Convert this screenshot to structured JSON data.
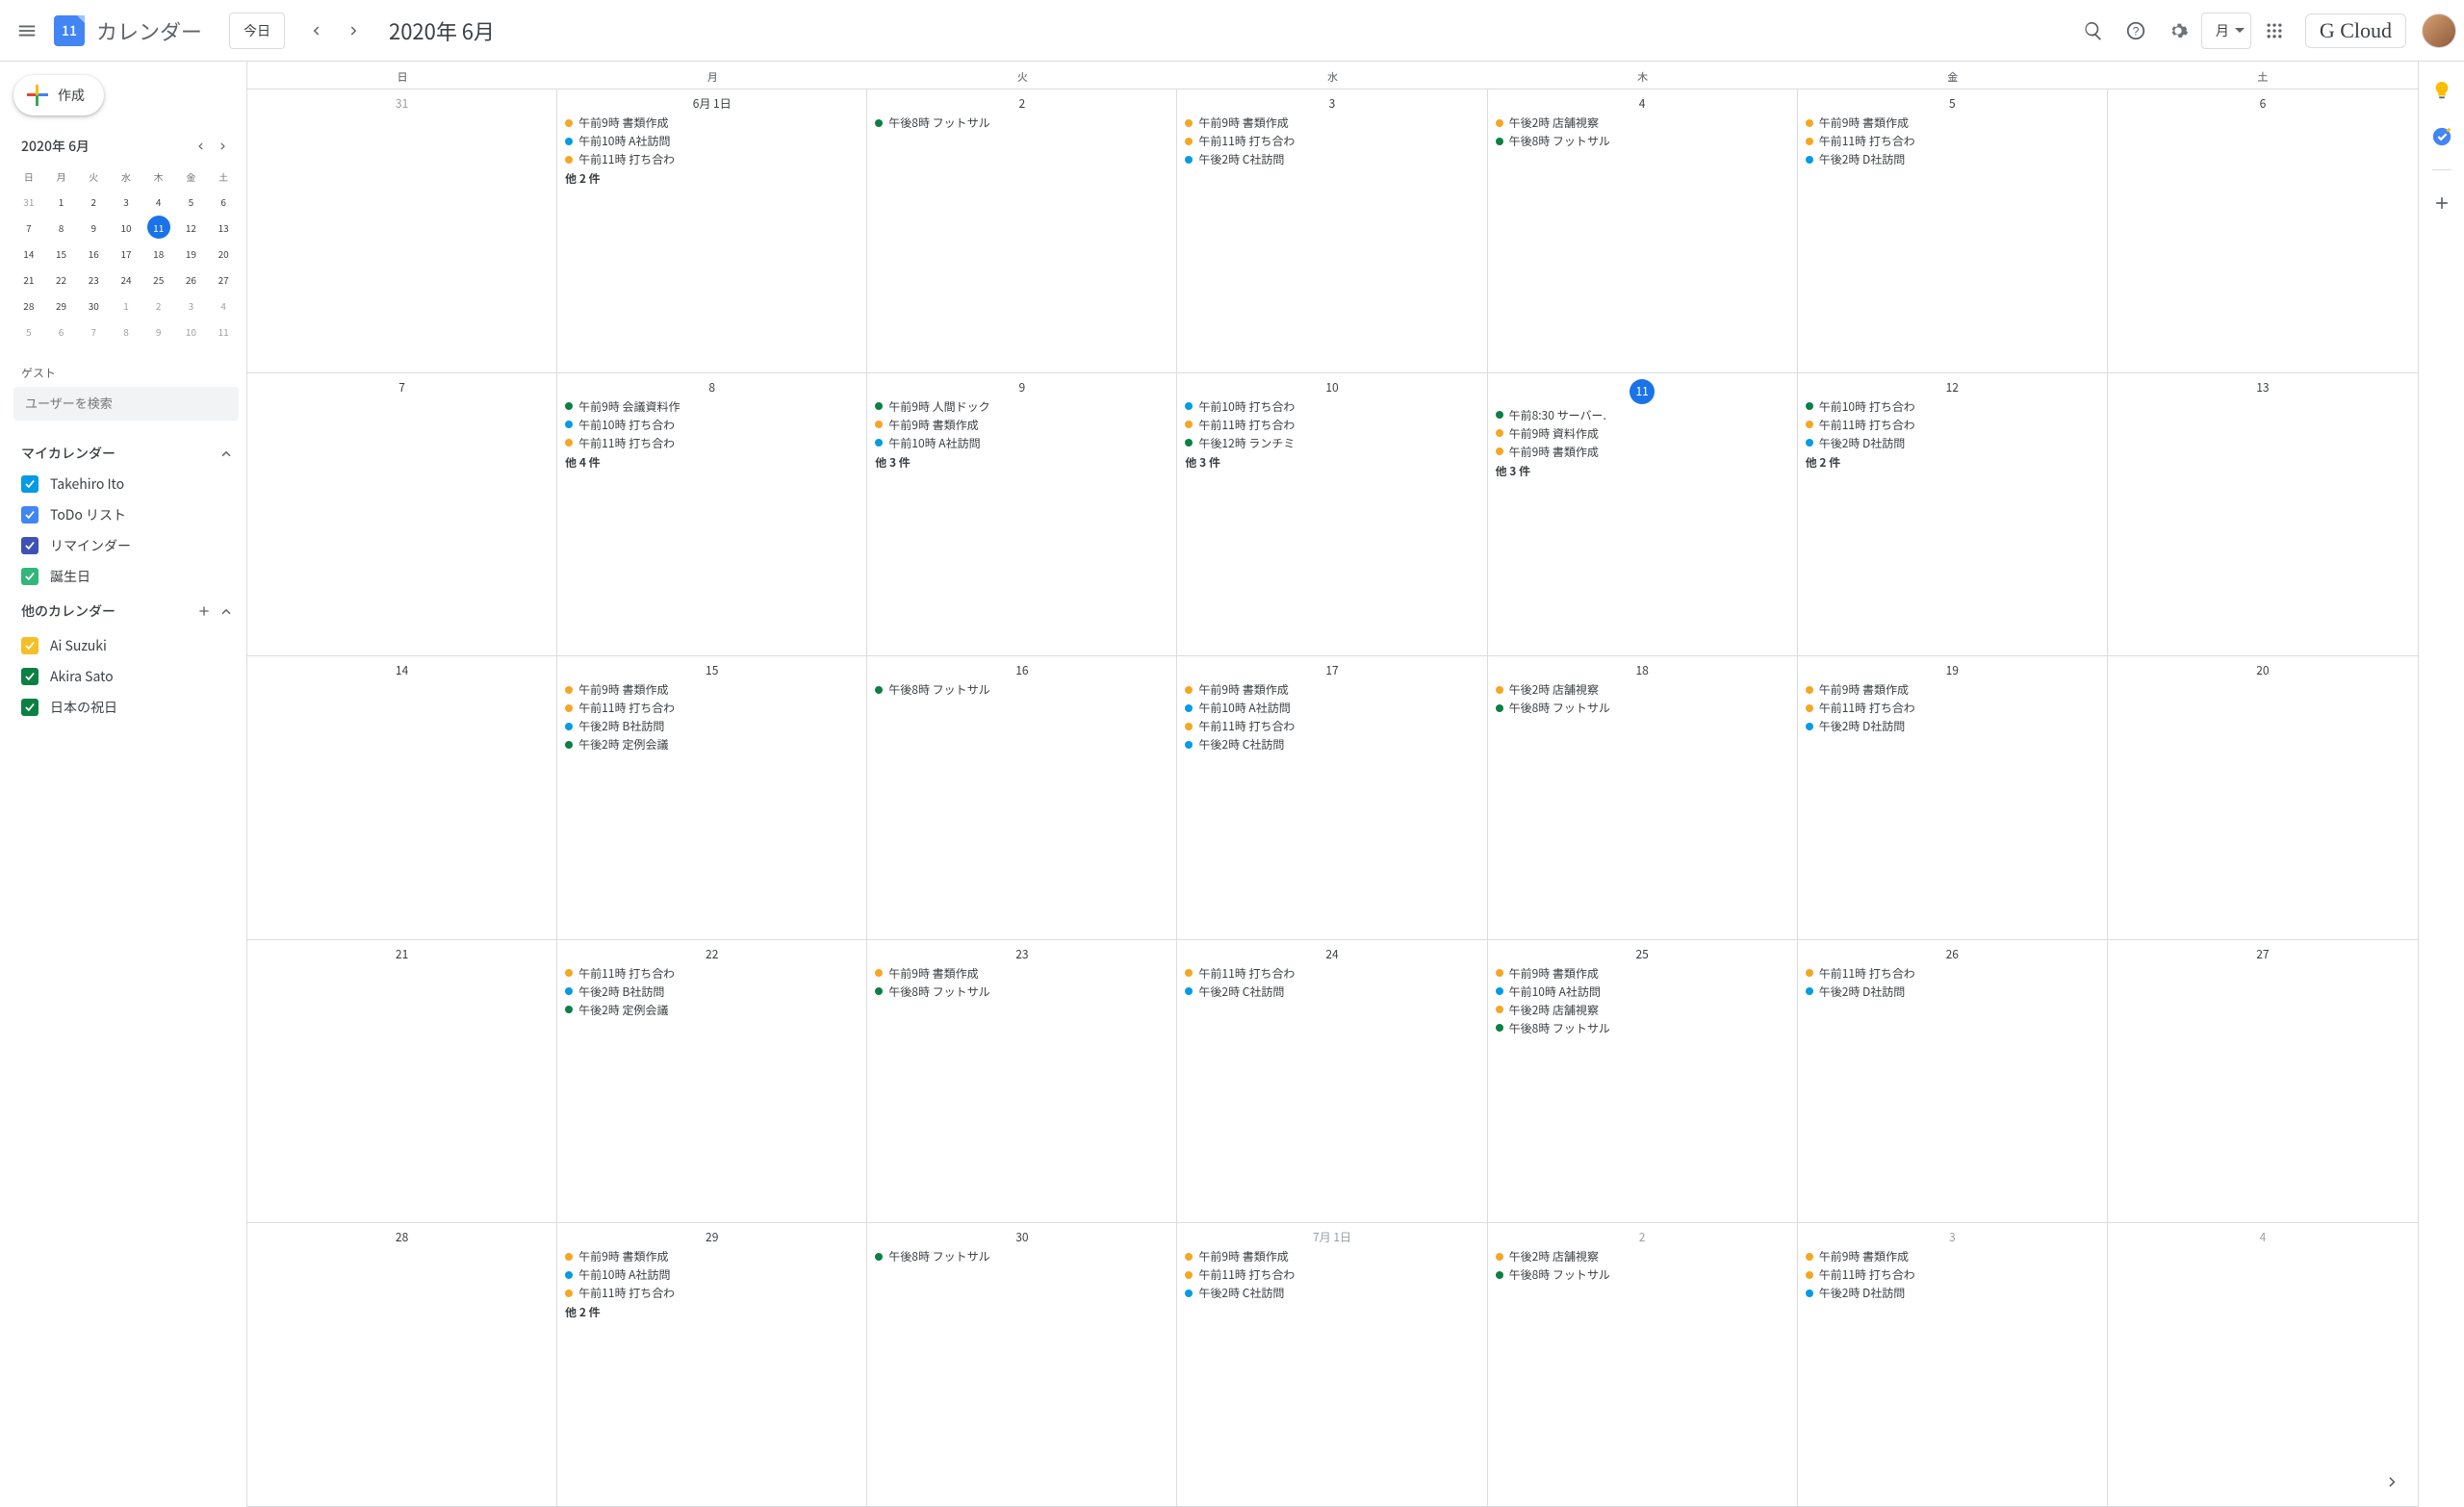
{
  "header": {
    "logo_day": "11",
    "app_title": "カレンダー",
    "today_label": "今日",
    "current_date": "2020年 6月",
    "view_label": "月",
    "brand": "G Cloud"
  },
  "sidebar": {
    "create_label": "作成",
    "mini_title": "2020年 6月",
    "mini_dow": [
      "日",
      "月",
      "火",
      "水",
      "木",
      "金",
      "土"
    ],
    "mini_days": [
      {
        "n": "31",
        "dim": true
      },
      {
        "n": "1"
      },
      {
        "n": "2"
      },
      {
        "n": "3"
      },
      {
        "n": "4"
      },
      {
        "n": "5"
      },
      {
        "n": "6"
      },
      {
        "n": "7"
      },
      {
        "n": "8"
      },
      {
        "n": "9"
      },
      {
        "n": "10"
      },
      {
        "n": "11",
        "today": true
      },
      {
        "n": "12"
      },
      {
        "n": "13"
      },
      {
        "n": "14"
      },
      {
        "n": "15"
      },
      {
        "n": "16"
      },
      {
        "n": "17"
      },
      {
        "n": "18"
      },
      {
        "n": "19"
      },
      {
        "n": "20"
      },
      {
        "n": "21"
      },
      {
        "n": "22"
      },
      {
        "n": "23"
      },
      {
        "n": "24"
      },
      {
        "n": "25"
      },
      {
        "n": "26"
      },
      {
        "n": "27"
      },
      {
        "n": "28"
      },
      {
        "n": "29"
      },
      {
        "n": "30"
      },
      {
        "n": "1",
        "dim": true
      },
      {
        "n": "2",
        "dim": true
      },
      {
        "n": "3",
        "dim": true
      },
      {
        "n": "4",
        "dim": true
      },
      {
        "n": "5",
        "dim": true
      },
      {
        "n": "6",
        "dim": true
      },
      {
        "n": "7",
        "dim": true
      },
      {
        "n": "8",
        "dim": true
      },
      {
        "n": "9",
        "dim": true
      },
      {
        "n": "10",
        "dim": true
      },
      {
        "n": "11",
        "dim": true
      }
    ],
    "guest_label": "ゲスト",
    "guest_placeholder": "ユーザーを検索",
    "my_cals_label": "マイカレンダー",
    "my_cals": [
      {
        "label": "Takehiro Ito",
        "color": "#039be5"
      },
      {
        "label": "ToDo リスト",
        "color": "#4285f4"
      },
      {
        "label": "リマインダー",
        "color": "#3f51b5"
      },
      {
        "label": "誕生日",
        "color": "#33b679"
      }
    ],
    "other_cals_label": "他のカレンダー",
    "other_cals": [
      {
        "label": "Ai Suzuki",
        "color": "#f6bf26"
      },
      {
        "label": "Akira Sato",
        "color": "#0b8043"
      },
      {
        "label": "日本の祝日",
        "color": "#0b8043"
      }
    ]
  },
  "calendar": {
    "dow": [
      "日",
      "月",
      "火",
      "水",
      "木",
      "金",
      "土"
    ],
    "colors": {
      "orange": "#f5a623",
      "blue": "#039be5",
      "green": "#0b8043"
    },
    "cells": [
      {
        "date": "31",
        "dim": true,
        "events": []
      },
      {
        "date": "6月 1日",
        "events": [
          {
            "c": "orange",
            "t": "午前9時 書類作成"
          },
          {
            "c": "blue",
            "t": "午前10時 A社訪問"
          },
          {
            "c": "orange",
            "t": "午前11時 打ち合わ"
          }
        ],
        "more": "他 2 件"
      },
      {
        "date": "2",
        "events": [
          {
            "c": "green",
            "t": "午後8時 フットサル"
          }
        ]
      },
      {
        "date": "3",
        "events": [
          {
            "c": "orange",
            "t": "午前9時 書類作成"
          },
          {
            "c": "orange",
            "t": "午前11時 打ち合わ"
          },
          {
            "c": "blue",
            "t": "午後2時 C社訪問"
          }
        ]
      },
      {
        "date": "4",
        "events": [
          {
            "c": "orange",
            "t": "午後2時 店舗視察"
          },
          {
            "c": "green",
            "t": "午後8時 フットサル"
          }
        ]
      },
      {
        "date": "5",
        "events": [
          {
            "c": "orange",
            "t": "午前9時 書類作成"
          },
          {
            "c": "orange",
            "t": "午前11時 打ち合わ"
          },
          {
            "c": "blue",
            "t": "午後2時 D社訪問"
          }
        ]
      },
      {
        "date": "6",
        "events": []
      },
      {
        "date": "7",
        "events": []
      },
      {
        "date": "8",
        "events": [
          {
            "c": "green",
            "t": "午前9時 会議資料作"
          },
          {
            "c": "blue",
            "t": "午前10時 打ち合わ"
          },
          {
            "c": "orange",
            "t": "午前11時 打ち合わ"
          }
        ],
        "more": "他 4 件"
      },
      {
        "date": "9",
        "events": [
          {
            "c": "green",
            "t": "午前9時 人間ドック"
          },
          {
            "c": "orange",
            "t": "午前9時 書類作成"
          },
          {
            "c": "blue",
            "t": "午前10時 A社訪問"
          }
        ],
        "more": "他 3 件"
      },
      {
        "date": "10",
        "events": [
          {
            "c": "blue",
            "t": "午前10時 打ち合わ"
          },
          {
            "c": "orange",
            "t": "午前11時 打ち合わ"
          },
          {
            "c": "green",
            "t": "午後12時 ランチミ"
          }
        ],
        "more": "他 3 件"
      },
      {
        "date": "11",
        "today": true,
        "events": [
          {
            "c": "green",
            "t": "午前8:30 サーバー."
          },
          {
            "c": "orange",
            "t": "午前9時 資料作成"
          },
          {
            "c": "orange",
            "t": "午前9時 書類作成"
          }
        ],
        "more": "他 3 件"
      },
      {
        "date": "12",
        "events": [
          {
            "c": "green",
            "t": "午前10時 打ち合わ"
          },
          {
            "c": "orange",
            "t": "午前11時 打ち合わ"
          },
          {
            "c": "blue",
            "t": "午後2時 D社訪問"
          }
        ],
        "more": "他 2 件"
      },
      {
        "date": "13",
        "events": []
      },
      {
        "date": "14",
        "events": []
      },
      {
        "date": "15",
        "events": [
          {
            "c": "orange",
            "t": "午前9時 書類作成"
          },
          {
            "c": "orange",
            "t": "午前11時 打ち合わ"
          },
          {
            "c": "blue",
            "t": "午後2時 B社訪問"
          },
          {
            "c": "green",
            "t": "午後2時 定例会議"
          }
        ]
      },
      {
        "date": "16",
        "events": [
          {
            "c": "green",
            "t": "午後8時 フットサル"
          }
        ]
      },
      {
        "date": "17",
        "events": [
          {
            "c": "orange",
            "t": "午前9時 書類作成"
          },
          {
            "c": "blue",
            "t": "午前10時 A社訪問"
          },
          {
            "c": "orange",
            "t": "午前11時 打ち合わ"
          },
          {
            "c": "blue",
            "t": "午後2時 C社訪問"
          }
        ]
      },
      {
        "date": "18",
        "events": [
          {
            "c": "orange",
            "t": "午後2時 店舗視察"
          },
          {
            "c": "green",
            "t": "午後8時 フットサル"
          }
        ]
      },
      {
        "date": "19",
        "events": [
          {
            "c": "orange",
            "t": "午前9時 書類作成"
          },
          {
            "c": "orange",
            "t": "午前11時 打ち合わ"
          },
          {
            "c": "blue",
            "t": "午後2時 D社訪問"
          }
        ]
      },
      {
        "date": "20",
        "events": []
      },
      {
        "date": "21",
        "events": []
      },
      {
        "date": "22",
        "events": [
          {
            "c": "orange",
            "t": "午前11時 打ち合わ"
          },
          {
            "c": "blue",
            "t": "午後2時 B社訪問"
          },
          {
            "c": "green",
            "t": "午後2時 定例会議"
          }
        ]
      },
      {
        "date": "23",
        "events": [
          {
            "c": "orange",
            "t": "午前9時 書類作成"
          },
          {
            "c": "green",
            "t": "午後8時 フットサル"
          }
        ]
      },
      {
        "date": "24",
        "events": [
          {
            "c": "orange",
            "t": "午前11時 打ち合わ"
          },
          {
            "c": "blue",
            "t": "午後2時 C社訪問"
          }
        ]
      },
      {
        "date": "25",
        "events": [
          {
            "c": "orange",
            "t": "午前9時 書類作成"
          },
          {
            "c": "blue",
            "t": "午前10時 A社訪問"
          },
          {
            "c": "orange",
            "t": "午後2時 店舗視察"
          },
          {
            "c": "green",
            "t": "午後8時 フットサル"
          }
        ]
      },
      {
        "date": "26",
        "events": [
          {
            "c": "orange",
            "t": "午前11時 打ち合わ"
          },
          {
            "c": "blue",
            "t": "午後2時 D社訪問"
          }
        ]
      },
      {
        "date": "27",
        "events": []
      },
      {
        "date": "28",
        "events": []
      },
      {
        "date": "29",
        "events": [
          {
            "c": "orange",
            "t": "午前9時 書類作成"
          },
          {
            "c": "blue",
            "t": "午前10時 A社訪問"
          },
          {
            "c": "orange",
            "t": "午前11時 打ち合わ"
          }
        ],
        "more": "他 2 件"
      },
      {
        "date": "30",
        "events": [
          {
            "c": "green",
            "t": "午後8時 フットサル"
          }
        ]
      },
      {
        "date": "7月 1日",
        "dim": true,
        "events": [
          {
            "c": "orange",
            "t": "午前9時 書類作成"
          },
          {
            "c": "orange",
            "t": "午前11時 打ち合わ"
          },
          {
            "c": "blue",
            "t": "午後2時 C社訪問"
          }
        ]
      },
      {
        "date": "2",
        "dim": true,
        "events": [
          {
            "c": "orange",
            "t": "午後2時 店舗視察"
          },
          {
            "c": "green",
            "t": "午後8時 フットサル"
          }
        ]
      },
      {
        "date": "3",
        "dim": true,
        "events": [
          {
            "c": "orange",
            "t": "午前9時 書類作成"
          },
          {
            "c": "orange",
            "t": "午前11時 打ち合わ"
          },
          {
            "c": "blue",
            "t": "午後2時 D社訪問"
          }
        ]
      },
      {
        "date": "4",
        "dim": true,
        "events": []
      }
    ]
  }
}
